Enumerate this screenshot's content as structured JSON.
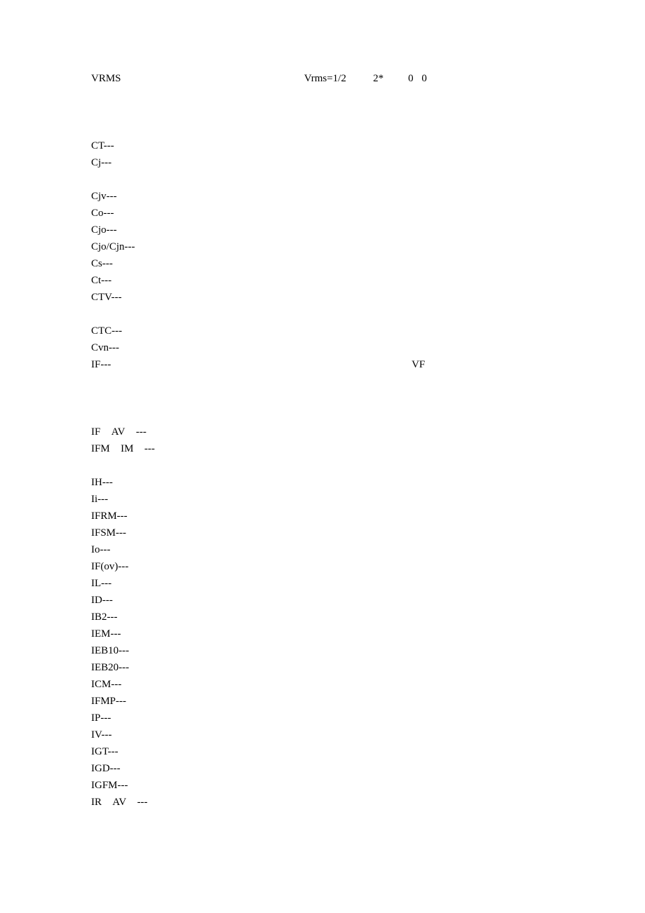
{
  "lines": [
    "VRMS 􀀀􀀀􀀀􀀀􀀀􀀀􀀀􀀀􀀀􀀀􀀀􀀀􀀀􀀀􀀀                      Vrms=1/2 􀀀􀀀   2*􀀀􀀀􀀀0􀀀0       􀀀􀀀",
    "􀀀􀀀􀀀",
    "",
    "􀀀􀀀􀀀􀀀􀀀􀀀􀀀􀀀􀀀􀀀􀀀􀀀􀀀",
    "CT---􀀀􀀀􀀀􀀀",
    "Cj---􀀀􀀀􀀀􀀀􀀀􀀀􀀀􀀀          􀀀􀀀􀀀􀀀􀀀􀀀􀀀􀀀􀀀􀀀􀀀􀀀􀀀􀀀􀀀􀀀􀀀􀀀􀀀􀀀􀀀􀀀􀀀",
    "􀀀",
    "Cjv---􀀀􀀀􀀀􀀀􀀀",
    "Co---􀀀􀀀􀀀􀀀􀀀",
    "Cjo---􀀀􀀀􀀀􀀀􀀀􀀀",
    "Cjo/Cjn---􀀀􀀀􀀀􀀀􀀀",
    "Cs---􀀀􀀀􀀀􀀀􀀀􀀀􀀀􀀀􀀀",
    "Ct---􀀀􀀀􀀀",
    "CTV---􀀀􀀀􀀀􀀀􀀀􀀀􀀀       􀀀􀀀􀀀􀀀􀀀􀀀􀀀         􀀀􀀀􀀀􀀀􀀀􀀀􀀀􀀀􀀀􀀀􀀀􀀀􀀀􀀀􀀀􀀀􀀀􀀀",
    "􀀀􀀀􀀀",
    "CTC---􀀀􀀀􀀀􀀀􀀀􀀀",
    "Cvn---􀀀􀀀􀀀􀀀",
    "IF---􀀀􀀀􀀀􀀀􀀀􀀀􀀀􀀀􀀀􀀀􀀀􀀀􀀀􀀀􀀀􀀀􀀀􀀀􀀀􀀀􀀀􀀀􀀀􀀀􀀀􀀀􀀀􀀀􀀀􀀀                     VF 􀀀􀀀",
    "􀀀􀀀􀀀􀀀􀀀􀀀􀀀􀀀         􀀀􀀀􀀀􀀀􀀀       􀀀􀀀􀀀􀀀􀀀􀀀􀀀􀀀􀀀􀀀􀀀􀀀              􀀀􀀀􀀀􀀀􀀀􀀀􀀀􀀀􀀀􀀀",
    "􀀀􀀀􀀀􀀀􀀀􀀀􀀀􀀀􀀀          􀀀􀀀􀀀􀀀􀀀     􀀀 􀀀􀀀􀀀􀀀􀀀􀀀􀀀􀀀􀀀􀀀􀀀􀀀􀀀􀀀􀀀􀀀􀀀􀀀􀀀􀀀",
    "􀀀􀀀􀀀􀀀􀀀􀀀􀀀􀀀􀀀􀀀􀀀􀀀􀀀􀀀􀀀􀀀􀀀􀀀􀀀􀀀􀀀􀀀",
    "IF􀀀 AV􀀀 ---􀀀􀀀􀀀􀀀􀀀􀀀",
    "IFM􀀀 IM􀀀 ---􀀀􀀀􀀀􀀀􀀀􀀀􀀀􀀀􀀀􀀀􀀀􀀀􀀀􀀀􀀀􀀀􀀀􀀀􀀀􀀀􀀀􀀀􀀀􀀀􀀀􀀀􀀀",
    "􀀀􀀀􀀀􀀀􀀀􀀀􀀀􀀀􀀀􀀀􀀀􀀀􀀀􀀀􀀀􀀀􀀀􀀀􀀀􀀀",
    "IH---􀀀􀀀􀀀􀀀􀀀􀀀􀀀􀀀􀀀􀀀",
    "Ii--- 􀀀􀀀􀀀􀀀􀀀􀀀􀀀􀀀􀀀",
    "IFRM---􀀀􀀀􀀀􀀀􀀀􀀀􀀀􀀀",
    "IFSM---􀀀􀀀􀀀􀀀􀀀􀀀􀀀􀀀􀀀􀀀􀀀􀀀􀀀􀀀􀀀",
    "Io---􀀀􀀀􀀀􀀀􀀀􀀀􀀀􀀀􀀀􀀀􀀀􀀀􀀀􀀀􀀀􀀀􀀀􀀀􀀀􀀀􀀀􀀀􀀀􀀀􀀀􀀀􀀀􀀀􀀀􀀀",
    "IF(ov)---􀀀􀀀􀀀􀀀􀀀􀀀",
    "IL---􀀀􀀀􀀀􀀀􀀀􀀀􀀀􀀀􀀀􀀀􀀀􀀀􀀀",
    "ID---􀀀􀀀􀀀",
    "IB2---􀀀􀀀􀀀􀀀􀀀􀀀􀀀􀀀􀀀􀀀􀀀􀀀􀀀",
    "IEM---􀀀􀀀􀀀􀀀􀀀􀀀􀀀",
    "IEB10---􀀀􀀀􀀀􀀀􀀀􀀀􀀀􀀀􀀀􀀀􀀀􀀀􀀀􀀀􀀀􀀀􀀀􀀀􀀀􀀀􀀀",
    "IEB20---􀀀􀀀􀀀􀀀􀀀􀀀􀀀􀀀􀀀􀀀􀀀􀀀􀀀􀀀􀀀",
    "ICM---􀀀􀀀􀀀􀀀􀀀􀀀􀀀􀀀",
    "IFMP---􀀀􀀀􀀀􀀀􀀀􀀀",
    "IP---􀀀􀀀􀀀􀀀",
    "IV---􀀀􀀀􀀀􀀀",
    "IGT---􀀀􀀀􀀀􀀀􀀀􀀀􀀀􀀀􀀀􀀀",
    "IGD---􀀀􀀀􀀀􀀀􀀀􀀀􀀀􀀀􀀀􀀀􀀀",
    "IGFM---􀀀􀀀􀀀􀀀􀀀􀀀􀀀􀀀􀀀",
    "IR􀀀 AV􀀀 ---􀀀􀀀􀀀􀀀􀀀􀀀"
  ]
}
